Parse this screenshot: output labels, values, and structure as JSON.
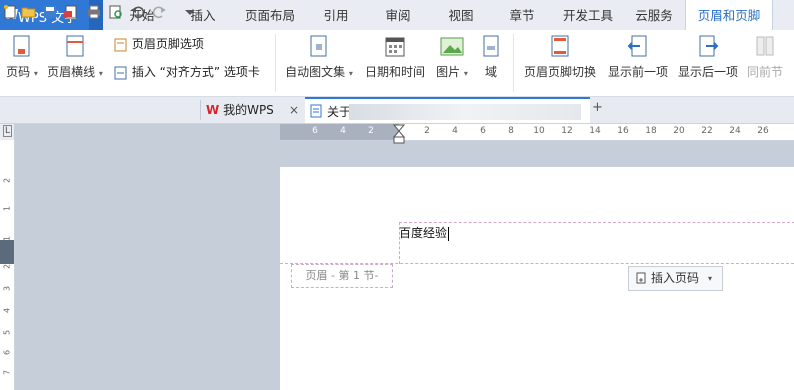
{
  "app": {
    "logo": "W",
    "title": "WPS 文字",
    "menu_caret": "▾"
  },
  "ribbon_tabs": [
    "开始",
    "插入",
    "页面布局",
    "引用",
    "审阅",
    "视图",
    "章节",
    "开发工具",
    "云服务",
    "页眉和页脚"
  ],
  "active_tab": "页眉和页脚",
  "ribbon": {
    "page_number": "页码",
    "header_line": "页眉横线",
    "header_footer_options": "页眉页脚选项",
    "insert_align_tab": "插入 “对齐方式” 选项卡",
    "auto_text": "自动图文集",
    "date_time": "日期和时间",
    "picture": "图片",
    "field": "域",
    "switch_header_footer": "页眉页脚切换",
    "show_previous": "显示前一项",
    "show_next": "显示后一项",
    "same_as_previous": "同前节"
  },
  "doc_tabs": [
    {
      "label": "我的WPS",
      "close": "×"
    },
    {
      "label": "关于"
    }
  ],
  "ruler": {
    "h_left": [
      "6",
      "4",
      "2"
    ],
    "h_right": [
      "2",
      "4",
      "6",
      "8",
      "10",
      "12",
      "14",
      "16",
      "18",
      "20",
      "22",
      "24",
      "26"
    ],
    "v": [
      "2",
      "1",
      "1",
      "2",
      "3",
      "4",
      "5",
      "6",
      "7"
    ]
  },
  "document": {
    "header_text": "百度经验",
    "header_label": "页眉  - 第 1 节-",
    "insert_page_number": "插入页码"
  },
  "colors": {
    "brand": "#2f78d6",
    "active_tab_text": "#2a6fc9",
    "header_dash": "#d4a8c8"
  }
}
